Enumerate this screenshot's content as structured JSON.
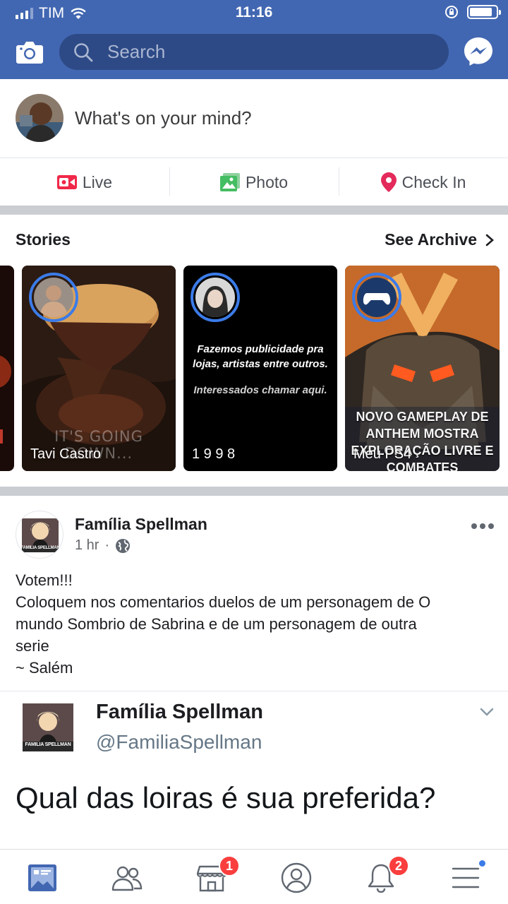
{
  "status_bar": {
    "carrier": "TIM",
    "time": "11:16",
    "battery_level": 0.85
  },
  "search": {
    "placeholder": "Search"
  },
  "composer": {
    "prompt": "What's on your mind?"
  },
  "actions": [
    {
      "label": "Live",
      "icon": "live-video-icon",
      "color": "#f02849"
    },
    {
      "label": "Photo",
      "icon": "photo-icon",
      "color": "#45bd62"
    },
    {
      "label": "Check In",
      "icon": "location-pin-icon",
      "color": "#e42a5b"
    }
  ],
  "stories": {
    "title": "Stories",
    "archive_label": "See Archive",
    "items": [
      {
        "name": "Tavi Castro",
        "overlay": "IT'S GOING DOWN..."
      },
      {
        "name": "1 9 9 8",
        "overlay_line1": "Fazemos publicidade pra",
        "overlay_line2": "lojas, artistas entre outros.",
        "overlay_line3": "Interessados chamar aqui."
      },
      {
        "name": "Meu PS4",
        "overlay_line1": "NOVO GAMEPLAY DE",
        "overlay_line2": "ANTHEM MOSTRA",
        "overlay_line3": "EXPLORAÇÃO LIVRE E",
        "overlay_line4": "COMBATES"
      }
    ]
  },
  "post": {
    "author": "Família Spellman",
    "time": "1 hr",
    "text_lines": [
      "Votem!!!",
      "Coloquem nos comentarios duelos de um personagem de O",
      "mundo Sombrio de Sabrina e de um personagem de outra",
      "serie",
      "~ Salém"
    ],
    "avatar_caption": "FAMILIA SPELLMAN",
    "embed": {
      "name": "Família Spellman",
      "handle": "@FamiliaSpellman",
      "text": "Qual das loiras é sua preferida?"
    }
  },
  "tabbar": {
    "marketplace_badge": "1",
    "notifications_badge": "2"
  },
  "colors": {
    "brand": "#4267b2",
    "accent": "#3b7be8",
    "badge": "#fa3e3e"
  }
}
